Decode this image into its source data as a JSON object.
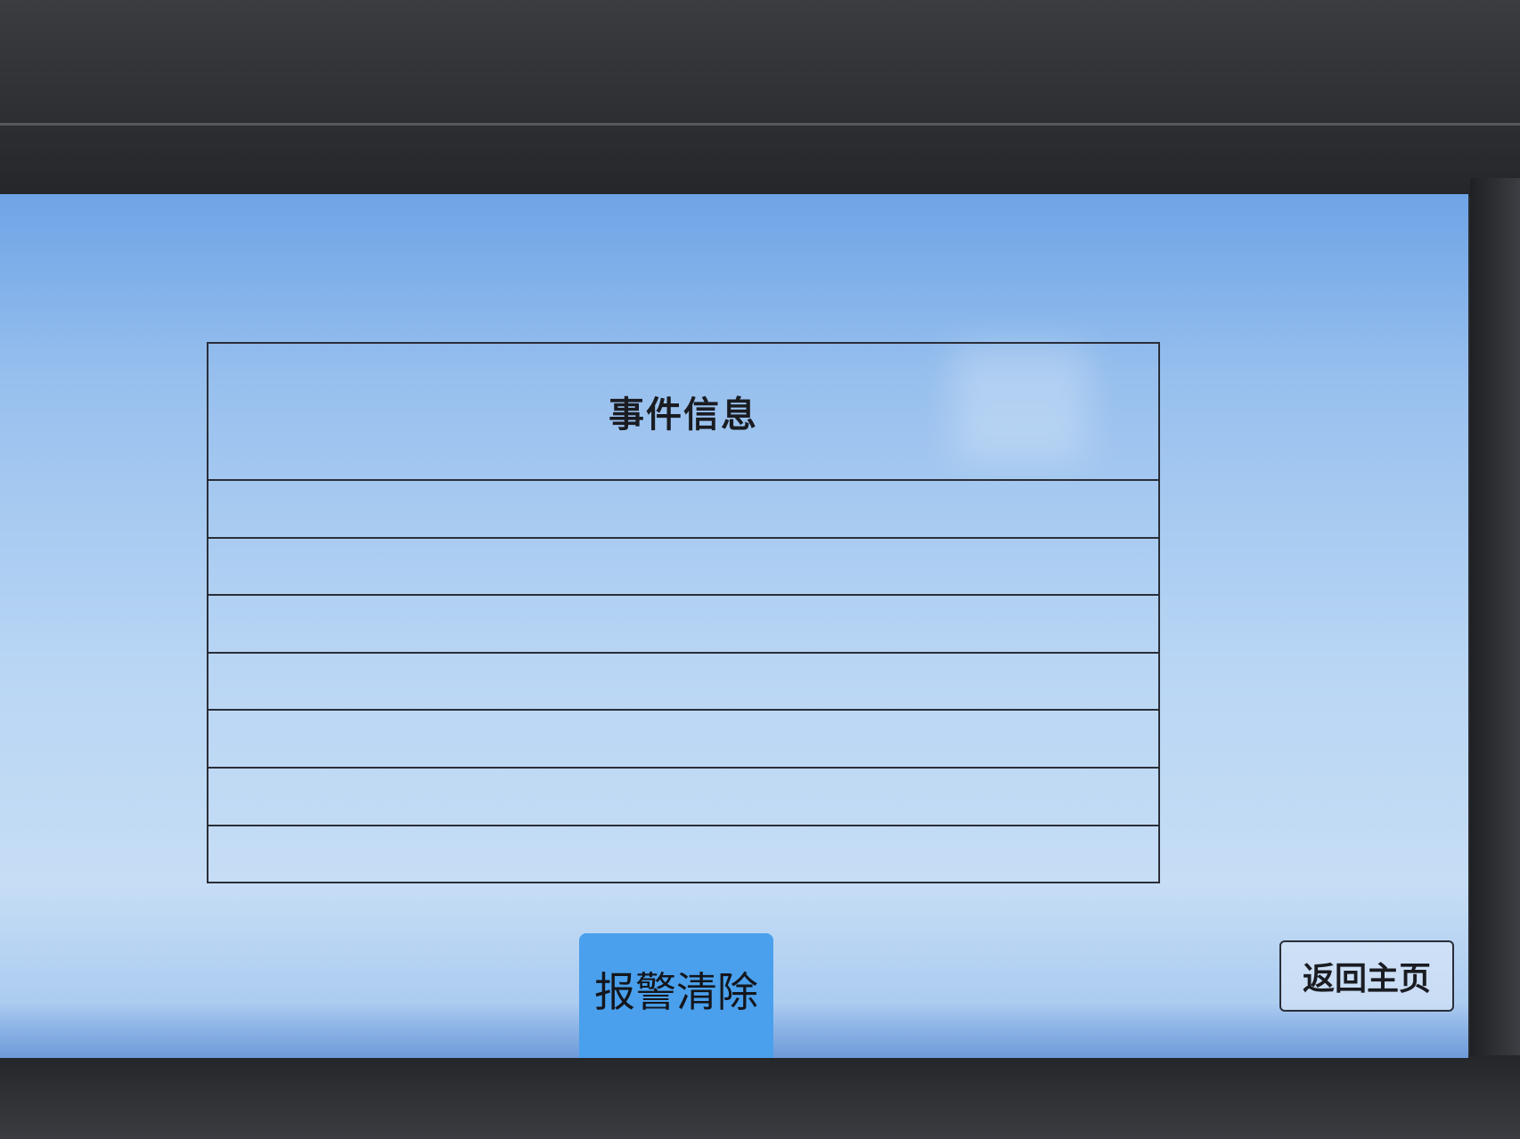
{
  "event_panel": {
    "title": "事件信息",
    "rows": [
      "",
      "",
      "",
      "",
      "",
      "",
      ""
    ]
  },
  "buttons": {
    "alarm_clear": "报警清除",
    "return_home": "返回主页"
  },
  "colors": {
    "screen_background": "#b9d6f4",
    "alarm_clear_button": "#4aa0ec",
    "bezel": "#2b2d31"
  }
}
